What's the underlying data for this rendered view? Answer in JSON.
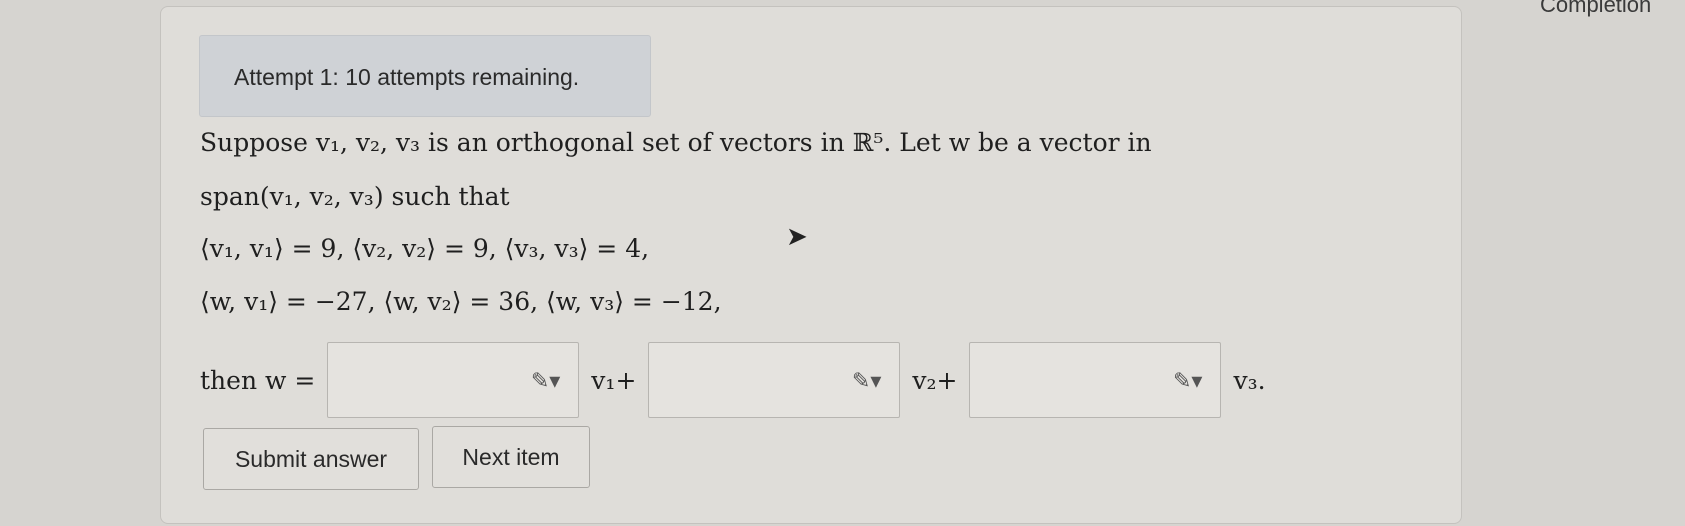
{
  "header": {
    "completion_label": "Completion"
  },
  "attempts": {
    "text": "Attempt 1: 10 attempts remaining."
  },
  "problem": {
    "line1": "Suppose v₁, v₂, v₃ is an orthogonal set of vectors in ℝ⁵. Let w be a vector in",
    "line2": "span(v₁, v₂, v₃) such that",
    "line3": "⟨v₁, v₁⟩ = 9,  ⟨v₂, v₂⟩ = 9,  ⟨v₃, v₃⟩ = 4,",
    "line4": "⟨w, v₁⟩ = −27,  ⟨w, v₂⟩ = 36,  ⟨w, v₃⟩ = −12,",
    "then_label": "then w =",
    "v1_label": "v₁+",
    "v2_label": "v₂+",
    "v3_label": "v₃."
  },
  "answers": [
    {
      "value": "",
      "icon": "pencil-dropdown-icon"
    },
    {
      "value": "",
      "icon": "pencil-dropdown-icon"
    },
    {
      "value": "",
      "icon": "pencil-dropdown-icon"
    }
  ],
  "buttons": {
    "submit_label": "Submit answer",
    "next_label": "Next item"
  }
}
